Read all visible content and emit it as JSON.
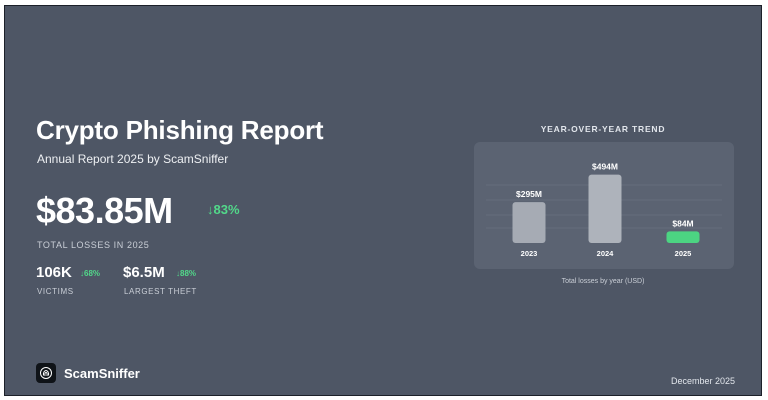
{
  "report": {
    "title": "Crypto Phishing Report",
    "subtitle": "Annual Report 2025 by ScamSniffer"
  },
  "headline": {
    "value": "$83.85M",
    "change": "83%",
    "change_icon": "arrow-down-icon",
    "caption": "TOTAL LOSSES IN 2025"
  },
  "stats": [
    {
      "value": "106K",
      "change": "68%",
      "change_icon": "arrow-down-icon",
      "caption": "VICTIMS"
    },
    {
      "value": "$6.5M",
      "change": "88%",
      "change_icon": "arrow-down-icon",
      "caption": "LARGEST THEFT"
    }
  ],
  "chart": {
    "heading": "YEAR-OVER-YEAR TREND",
    "footnote": "Total losses by year (USD)"
  },
  "chart_data": {
    "type": "bar",
    "title": "YEAR-OVER-YEAR TREND",
    "categories": [
      "2023",
      "2024",
      "2025"
    ],
    "values": [
      295,
      494,
      84
    ],
    "data_labels": [
      "$295M",
      "$494M",
      "$84M"
    ],
    "unit": "USD millions",
    "xlabel": "Total losses by year (USD)",
    "ylabel": "",
    "ylim": [
      0,
      520
    ],
    "grid": true,
    "colors": [
      "#a6abb4",
      "#aeb3bb",
      "#4cd482"
    ]
  },
  "brand": {
    "name": "ScamSniffer",
    "logo_icon": "fingerprint-icon"
  },
  "date": "December 2025",
  "colors": {
    "background": "#4e5665",
    "panel": "#5b6372",
    "positive": "#52d88a",
    "text": "#ffffff"
  }
}
